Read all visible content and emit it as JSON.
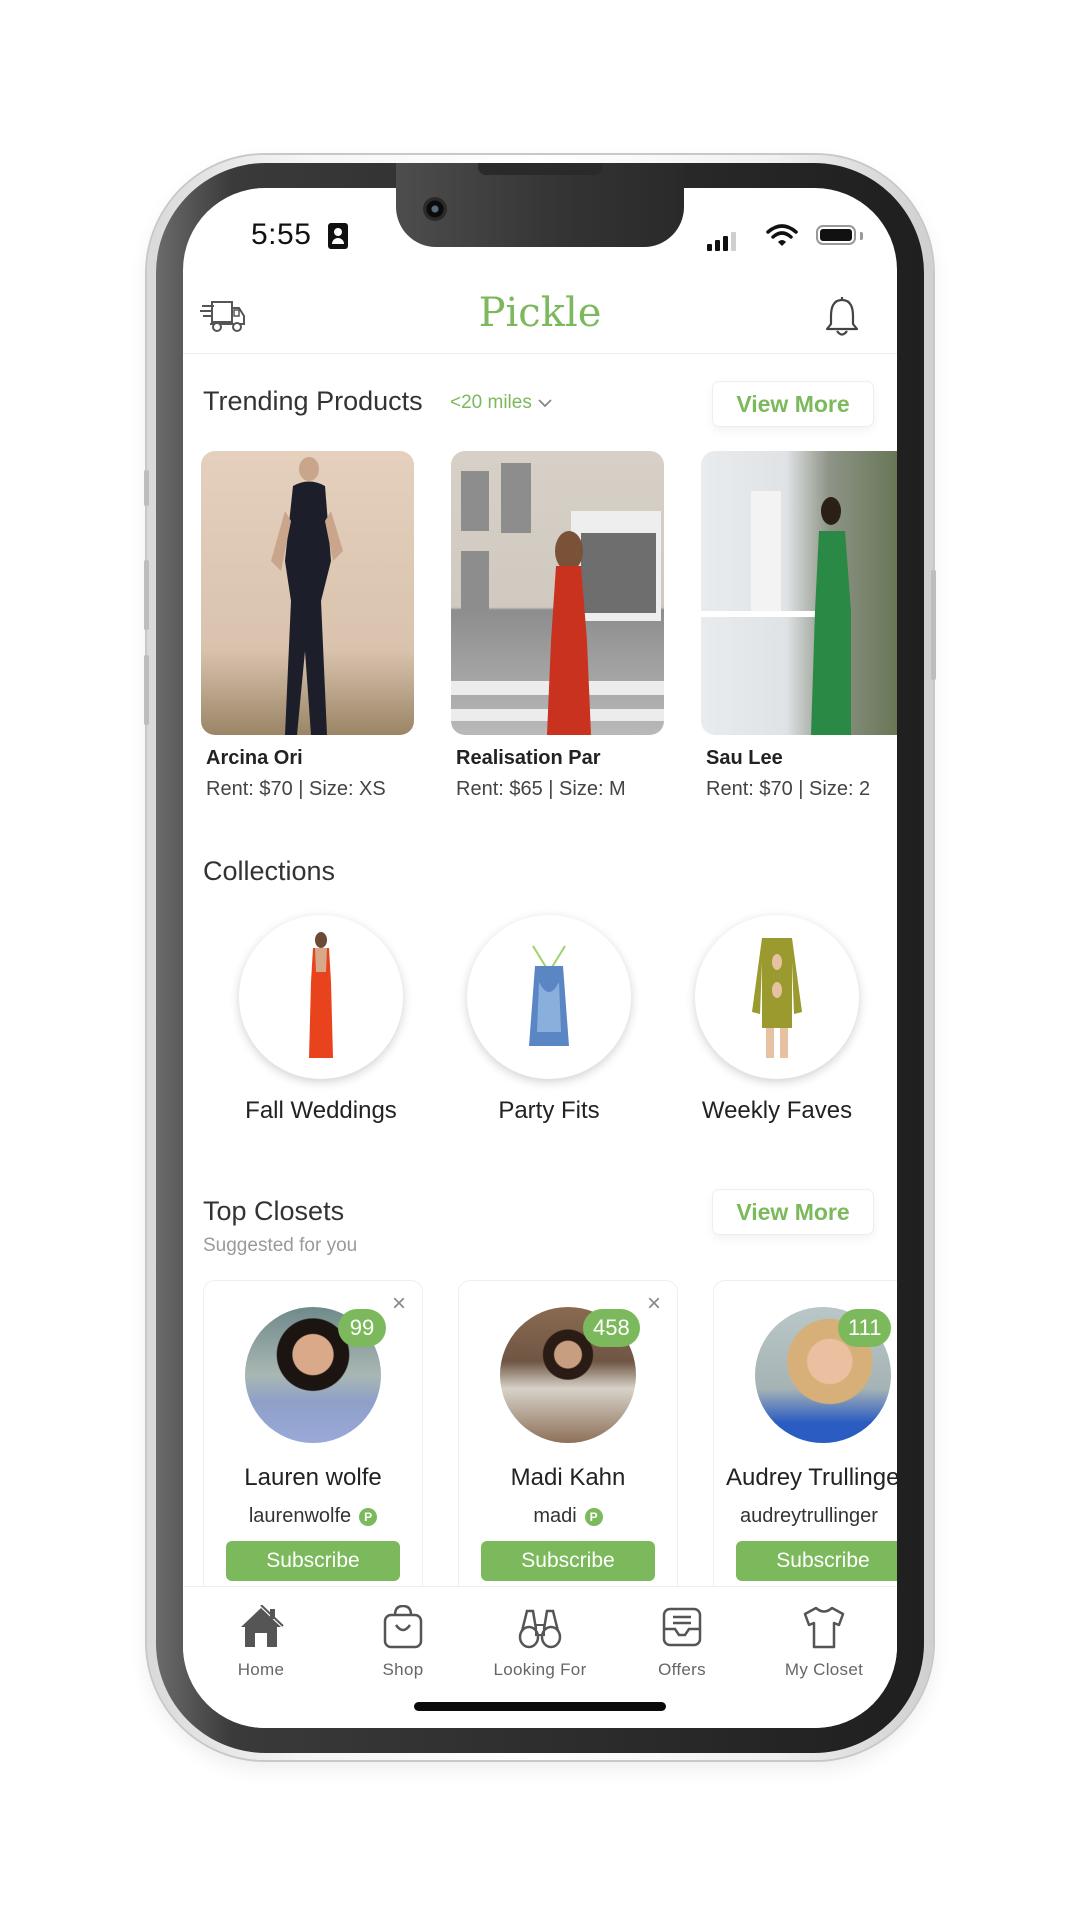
{
  "status_bar": {
    "time": "5:55",
    "icons": [
      "person-badge-icon",
      "cellular-signal-icon",
      "wifi-icon",
      "battery-icon"
    ]
  },
  "header": {
    "left_icon": "delivery-truck-icon",
    "title": "Pickle",
    "right_icon": "bell-icon"
  },
  "colors": {
    "accent": "#7cb95c",
    "text": "#222222",
    "muted": "#9a9a9a"
  },
  "trending": {
    "title": "Trending Products",
    "distance_filter": "<20 miles",
    "distance_icon": "chevron-down-icon",
    "view_more": "View More",
    "products": [
      {
        "name": "Arcina Ori",
        "meta": "Rent: $70 | Size: XS",
        "dress_color": "#1c1f2a"
      },
      {
        "name": "Realisation Par",
        "meta": "Rent: $65 | Size: M",
        "dress_color": "#c8321e"
      },
      {
        "name": "Sau Lee",
        "meta": "Rent: $70 | Size: 2",
        "dress_color": "#2a8a45"
      }
    ]
  },
  "collections": {
    "title": "Collections",
    "items": [
      {
        "label": "Fall Weddings",
        "dress_color": "#e8431c"
      },
      {
        "label": "Party Fits",
        "dress_color": "#5a86c4"
      },
      {
        "label": "Weekly Faves",
        "dress_color": "#9a9a2e"
      }
    ]
  },
  "top_closets": {
    "title": "Top Closets",
    "subtitle": "Suggested for you",
    "view_more": "View More",
    "closets": [
      {
        "name": "Lauren wolfe",
        "username": "laurenwolfe",
        "count": "99",
        "subscribe": "Subscribe",
        "verified": true,
        "dismissible": true
      },
      {
        "name": "Madi Kahn",
        "username": "madi",
        "count": "458",
        "subscribe": "Subscribe",
        "verified": true,
        "dismissible": true
      },
      {
        "name": "Audrey Trullinger",
        "username": "audreytrullinger",
        "count": "111",
        "subscribe": "Subscribe",
        "verified": false,
        "dismissible": false
      }
    ]
  },
  "bottom_nav": {
    "items": [
      {
        "label": "Home",
        "icon": "home-icon",
        "active": true
      },
      {
        "label": "Shop",
        "icon": "shopping-bag-icon",
        "active": false
      },
      {
        "label": "Looking For",
        "icon": "binoculars-icon",
        "active": false
      },
      {
        "label": "Offers",
        "icon": "inbox-tray-icon",
        "active": false
      },
      {
        "label": "My Closet",
        "icon": "tshirt-icon",
        "active": false
      }
    ]
  }
}
